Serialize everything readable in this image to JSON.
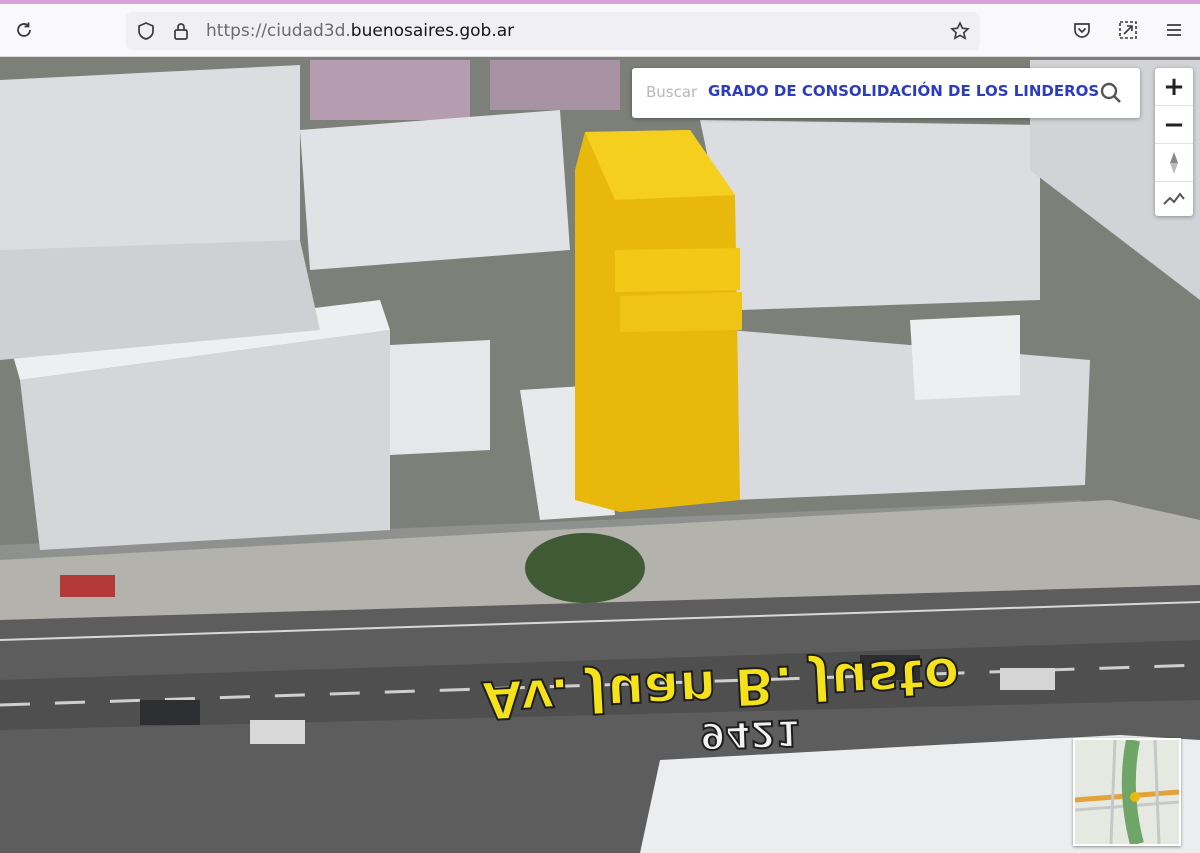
{
  "browser": {
    "url_prefix": "https://ciudad3d.",
    "url_host": "buenosaires.gob.ar",
    "url_suffix": "",
    "icons": [
      "reload-icon",
      "shield-icon",
      "lock-icon",
      "star-icon",
      "pocket-icon",
      "extension-icon",
      "menu-icon"
    ]
  },
  "search": {
    "label": "Buscar",
    "query": "GRADO DE CONSOLIDACIÓN DE LOS LINDEROS",
    "icon": "search-icon"
  },
  "map_controls": {
    "zoom_in": "+",
    "zoom_out": "−",
    "icons": [
      "compass-icon",
      "profile-icon"
    ]
  },
  "street_label": {
    "text": "Av. Juan B. Justo",
    "number": "9421"
  },
  "colors": {
    "highlight_building": "#f1c40f",
    "street_text": "#f5e21a",
    "search_query": "#2c3cbf",
    "tab_accent": "#d6a4d8"
  }
}
